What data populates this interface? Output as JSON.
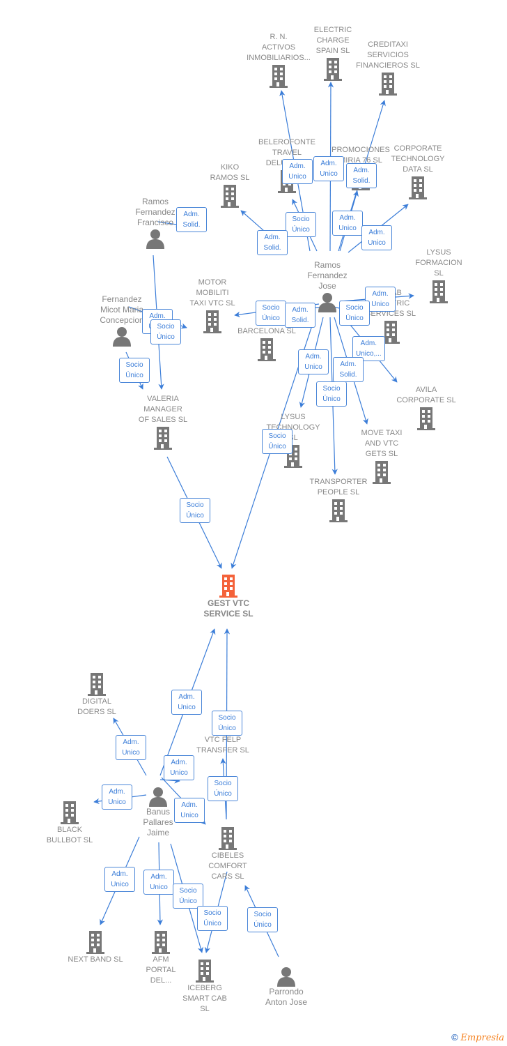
{
  "colors": {
    "edge": "#3b7dd8",
    "node": "#777777",
    "focus": "#f4623a",
    "label": "#888888"
  },
  "focus": {
    "id": "gest",
    "label": "GEST VTC\nSERVICE  SL"
  },
  "nodes": [
    {
      "id": "rn",
      "type": "company",
      "label": "R. N.\nACTIVOS\nINMOBILIARIOS..."
    },
    {
      "id": "electric",
      "type": "company",
      "label": "ELECTRIC\nCHARGE\nSPAIN  SL"
    },
    {
      "id": "creditaxi",
      "type": "company",
      "label": "CREDITAXI\nSERVICIOS\nFINANCIEROS SL"
    },
    {
      "id": "belero",
      "type": "company",
      "label": "BELEROFONTE\nTRAVEL\nDELUXE  SL"
    },
    {
      "id": "kiko",
      "type": "company",
      "label": "KIKO\nRAMOS SL"
    },
    {
      "id": "promo",
      "type": "company",
      "label": "PROMOCIONES\nMIRIA 76 SL"
    },
    {
      "id": "corptech",
      "type": "company",
      "label": "CORPORATE\nTECHNOLOGY\nDATA SL"
    },
    {
      "id": "rff",
      "type": "person",
      "label": "Ramos\nFernandez\nFrancisco"
    },
    {
      "id": "rfj",
      "type": "person",
      "label": "Ramos\nFernandez\nJose"
    },
    {
      "id": "lysusf",
      "type": "company",
      "label": "LYSUS\nFORMACION\nSL"
    },
    {
      "id": "motor",
      "type": "company",
      "label": "MOTOR\nMOBILITI\nTAXI VTC  SL"
    },
    {
      "id": "fmmc",
      "type": "person",
      "label": "Fernandez\nMicot Maria\nConcepcion"
    },
    {
      "id": "crbcn",
      "type": "company",
      "label": "CR...\nBARCELONA SL"
    },
    {
      "id": "cab",
      "type": "company",
      "label": "...CAB\nELECTRIC\nSERVICES  SL"
    },
    {
      "id": "avila",
      "type": "company",
      "label": "AVILA\nCORPORATE SL"
    },
    {
      "id": "valeria",
      "type": "company",
      "label": "VALERIA\nMANAGER\nOF SALES  SL"
    },
    {
      "id": "lysust",
      "type": "company",
      "label": "LYSUS\nTECHNOLOGY\nSL"
    },
    {
      "id": "movetaxi",
      "type": "company",
      "label": "MOVE TAXI\nAND VTC\nGETS  SL"
    },
    {
      "id": "transp",
      "type": "company",
      "label": "TRANSPORTER\nPEOPLE  SL"
    },
    {
      "id": "digital",
      "type": "company",
      "label": "DIGITAL\nDOERS  SL"
    },
    {
      "id": "vtcfelp",
      "type": "company",
      "label": "VTC FELP\nTRANSFER  SL"
    },
    {
      "id": "bpj",
      "type": "person",
      "label": "Banus\nPallares\nJaime"
    },
    {
      "id": "black",
      "type": "company",
      "label": "BLACK\nBULLBOT  SL"
    },
    {
      "id": "cibeles",
      "type": "company",
      "label": "CIBELES\nCOMFORT\nCARS  SL"
    },
    {
      "id": "nextband",
      "type": "company",
      "label": "NEXT BAND  SL"
    },
    {
      "id": "afm",
      "type": "company",
      "label": "AFM\nPORTAL\nDEL..."
    },
    {
      "id": "iceberg",
      "type": "company",
      "label": "ICEBERG\nSMART CAB\nSL"
    },
    {
      "id": "paj",
      "type": "person",
      "label": "Parrondo\nAnton Jose"
    }
  ],
  "edges": [
    {
      "from": "rfj",
      "to": "rn",
      "label": "Adm.\nUnico"
    },
    {
      "from": "rfj",
      "to": "electric",
      "label": "Adm.\nUnico"
    },
    {
      "from": "rfj",
      "to": "creditaxi",
      "label": "Adm.\nSolid."
    },
    {
      "from": "rfj",
      "to": "belero",
      "label": "Socio\nÚnico"
    },
    {
      "from": "rfj",
      "to": "kiko",
      "label": "Adm.\nSolid."
    },
    {
      "from": "rfj",
      "to": "promo",
      "label": "Adm.\nUnico"
    },
    {
      "from": "rfj",
      "to": "corptech",
      "label": "Adm.\nUnico"
    },
    {
      "from": "rff",
      "to": "kiko",
      "label": "Adm.\nSolid."
    },
    {
      "from": "rfj",
      "to": "crbcn",
      "label": "Socio\nÚnico"
    },
    {
      "from": "rfj",
      "to": "motor",
      "label": "Adm.\nSolid."
    },
    {
      "from": "rfj",
      "to": "cab",
      "label": "Adm.\nUnico"
    },
    {
      "from": "rfj",
      "to": "cab2",
      "label": "Socio\nÚnico"
    },
    {
      "from": "rfj",
      "to": "avila",
      "label": "Adm.\nUnico,..."
    },
    {
      "from": "rfj",
      "to": "lysust",
      "label": "Adm.\nUnico"
    },
    {
      "from": "rfj",
      "to": "movetaxi",
      "label": "Adm.\nSolid."
    },
    {
      "from": "rfj",
      "to": "transp",
      "label": "Socio\nÚnico"
    },
    {
      "from": "rfj",
      "to": "gest",
      "label": "Socio\nÚnico"
    },
    {
      "from": "fmmc",
      "to": "motor",
      "label": "Adm.\nUnico"
    },
    {
      "from": "rff",
      "to": "valeria",
      "label": "Socio\nÚnico"
    },
    {
      "from": "fmmc",
      "to": "valeria",
      "label": "Socio\nÚnico"
    },
    {
      "from": "valeria",
      "to": "gest",
      "label": "Socio\nÚnico"
    },
    {
      "from": "bpj",
      "to": "gest",
      "label": "Adm.\nUnico"
    },
    {
      "from": "cibeles",
      "to": "gest",
      "label": "Socio\nÚnico"
    },
    {
      "from": "bpj",
      "to": "digital",
      "label": "Adm.\nUnico"
    },
    {
      "from": "bpj",
      "to": "vtcfelp",
      "label": "Adm.\nUnico"
    },
    {
      "from": "cibeles",
      "to": "vtcfelp",
      "label": "Socio\nÚnico"
    },
    {
      "from": "bpj",
      "to": "black",
      "label": "Adm.\nUnico"
    },
    {
      "from": "bpj",
      "to": "cibeles",
      "label": "Adm.\nUnico"
    },
    {
      "from": "bpj",
      "to": "nextband",
      "label": "Adm.\nUnico"
    },
    {
      "from": "bpj",
      "to": "afm",
      "label": "Adm.\nUnico"
    },
    {
      "from": "bpj",
      "to": "afm2",
      "label": "Socio\nÚnico"
    },
    {
      "from": "cibeles",
      "to": "iceberg",
      "label": "Socio\nÚnico"
    },
    {
      "from": "paj",
      "to": "cibeles",
      "label": "Socio\nÚnico"
    }
  ],
  "footer": {
    "copyright": "©",
    "brand": "Empresia"
  }
}
